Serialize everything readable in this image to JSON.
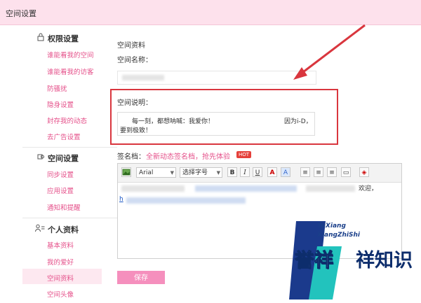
{
  "header": {
    "title": "空间设置"
  },
  "sidebar": {
    "sections": [
      {
        "title": "权限设置",
        "icon": "lock-icon",
        "items": [
          "谁能看我的空间",
          "谁能看我的访客",
          "防骚扰",
          "隐身设置",
          "封存我的动态",
          "去广告设置"
        ]
      },
      {
        "title": "空间设置",
        "icon": "gear-icon",
        "items": [
          "同步设置",
          "应用设置",
          "通知和提醒"
        ]
      },
      {
        "title": "个人资料",
        "icon": "profile-icon",
        "items": [
          "基本资料",
          "我的爱好",
          "空间资料",
          "空间头像"
        ]
      }
    ],
    "active_item": "空间资料"
  },
  "main": {
    "heading": "空间资料",
    "name_label": "空间名称：",
    "desc_label": "空间说明：",
    "desc_line1a": "每一刻，都想呐喊：我爱你！",
    "desc_line1b": "因为i-D，",
    "desc_line2": "要到极致！",
    "sig_label": "签名档：",
    "sig_link": "全新动态签名档，抢先体验",
    "hot_badge": "HOT",
    "editor_font": "Arial",
    "editor_size": "选择字号",
    "editor_text_tail": "欢迎，",
    "editor_link_start": "h",
    "save_label": "保存"
  },
  "watermark": {
    "line1": "YuXiang",
    "line2": "XiangZhiShi",
    "cn1": "誉祥",
    "cn2": "祥知识"
  },
  "colors": {
    "accent": "#e5508a",
    "highlight": "#d9363e",
    "topbar": "#fde1ec",
    "watermark_blue": "#1a3f8a",
    "watermark_teal": "#1ec9c0"
  }
}
